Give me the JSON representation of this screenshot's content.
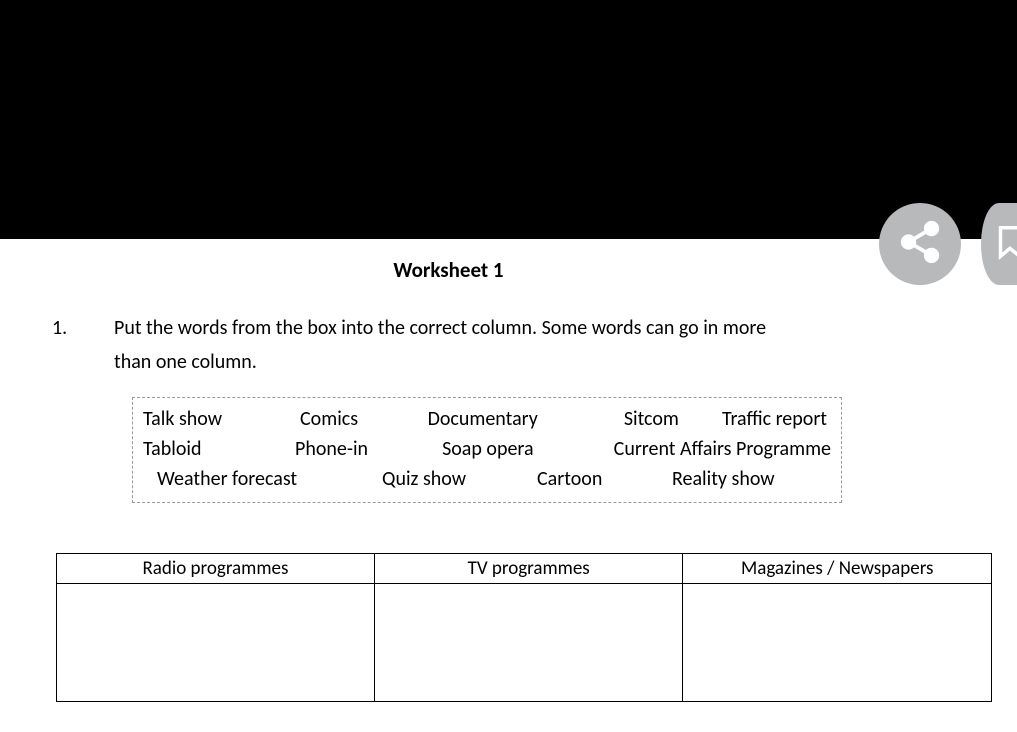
{
  "title": "Worksheet 1",
  "instruction": {
    "number": "1.",
    "text_line1": "Put the words from the box into the correct column. Some words can go in more",
    "text_line2": "than one column."
  },
  "wordbox": {
    "row1": {
      "w1": "Talk show",
      "w2": "Comics",
      "w3": "Documentary",
      "w4": "Sitcom",
      "w5": "Traffic report"
    },
    "row2": {
      "w1": "Tabloid",
      "w2": "Phone-in",
      "w3": "Soap opera",
      "w4": "Current Affairs Programme"
    },
    "row3": {
      "w1": "Weather forecast",
      "w2": "Quiz show",
      "w3": "Cartoon",
      "w4": "Reality show"
    }
  },
  "table": {
    "headers": {
      "col1": "Radio programmes",
      "col2": "TV programmes",
      "col3": "Magazines / Newspapers"
    },
    "cells": {
      "c1": "",
      "c2": "",
      "c3": ""
    }
  }
}
